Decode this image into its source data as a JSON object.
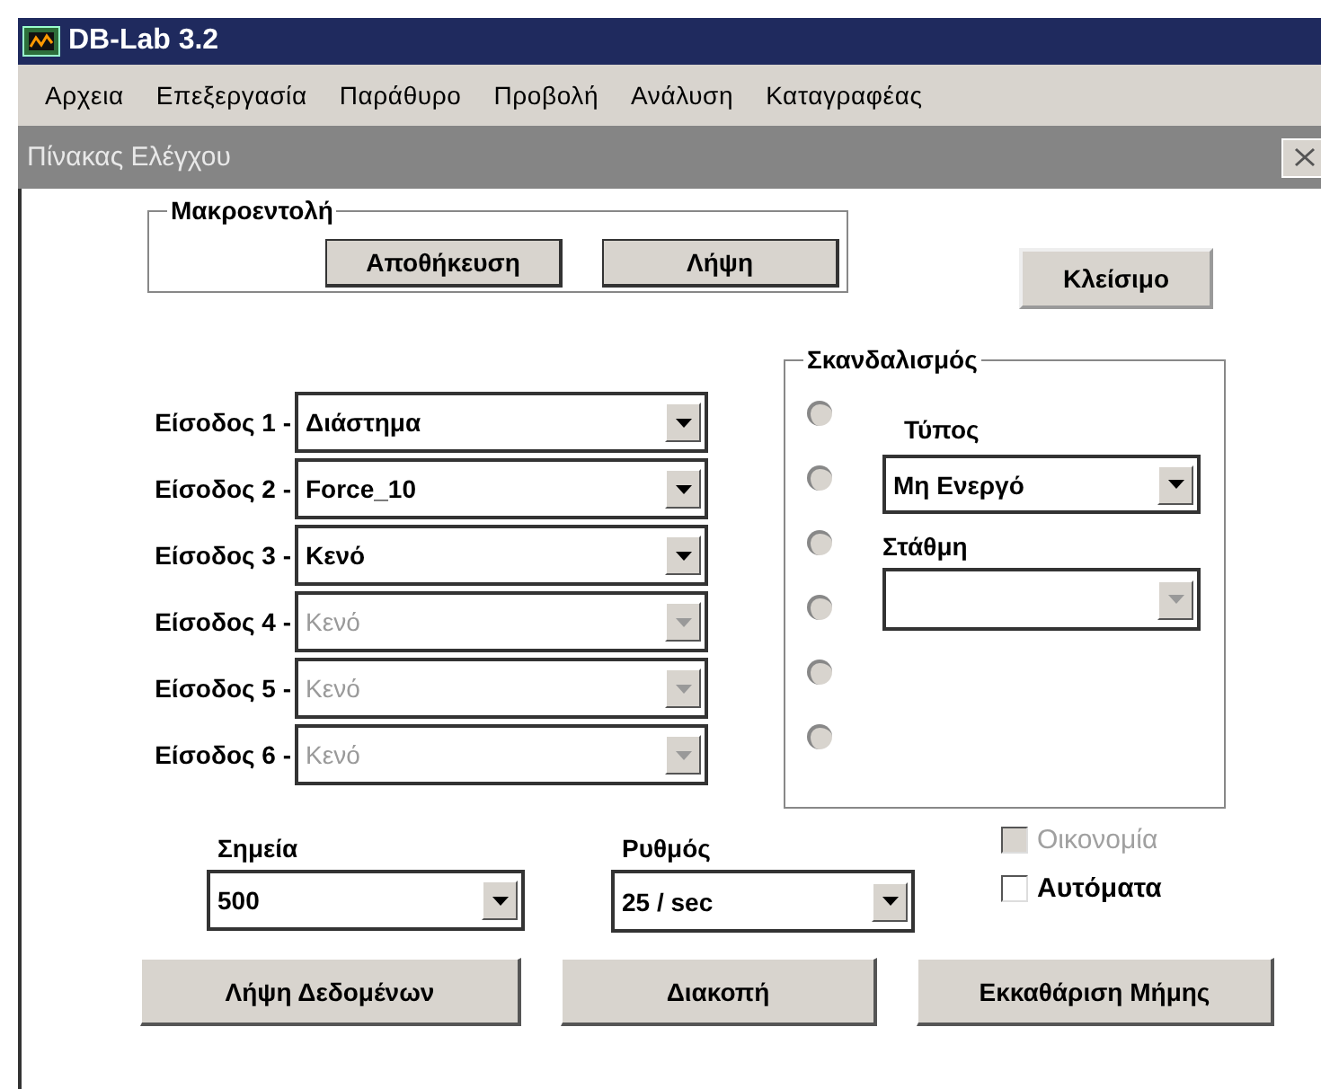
{
  "window": {
    "title": "DB-Lab 3.2"
  },
  "menu": [
    "Αρχεια",
    "Επεξεργασία",
    "Παράθυρο",
    "Προβολή",
    "Ανάλυση",
    "Καταγραφέας"
  ],
  "dialog": {
    "title": "Πίνακας Ελέγχου",
    "macro": {
      "legend": "Μακροεντολή",
      "buttons": [
        "Αποθήκευση",
        "Λήψη"
      ]
    },
    "close_button": "Κλείσιμο",
    "inputs": [
      {
        "label": "Είσοδος 1 -",
        "value": "Διάστημα",
        "disabled": false
      },
      {
        "label": "Είσοδος 2 -",
        "value": "Force_10",
        "disabled": false
      },
      {
        "label": "Είσοδος 3 -",
        "value": "Κενό",
        "disabled": false
      },
      {
        "label": "Είσοδος 4 -",
        "value": "Κενό",
        "disabled": true
      },
      {
        "label": "Είσοδος 5 -",
        "value": "Κενό",
        "disabled": true
      },
      {
        "label": "Είσοδος 6 -",
        "value": "Κενό",
        "disabled": true
      }
    ],
    "trigger": {
      "legend": "Σκανδαλισμός",
      "channels": [
        {
          "selected": false
        },
        {
          "selected": false
        },
        {
          "selected": false
        },
        {
          "selected": false
        },
        {
          "selected": false
        },
        {
          "selected": false
        }
      ],
      "type_label": "Τύπος",
      "type": {
        "value": "Μη Ενεργό",
        "disabled": false
      },
      "level_label": "Στάθμη",
      "level_select": {
        "disabled": true
      }
    },
    "points": {
      "label": "Σημεία",
      "value": "500"
    },
    "rate": {
      "label": "Ρυθμός",
      "value": "25 / sec"
    },
    "options": [
      {
        "label": "Οικονομία",
        "checked": false,
        "disabled": true
      },
      {
        "label": "Αυτόματα",
        "checked": false,
        "disabled": false
      }
    ],
    "buttons": [
      "Λήψη Δεδομένων",
      "Διακοπή",
      "Εκκαθάριση Μήμης"
    ]
  }
}
